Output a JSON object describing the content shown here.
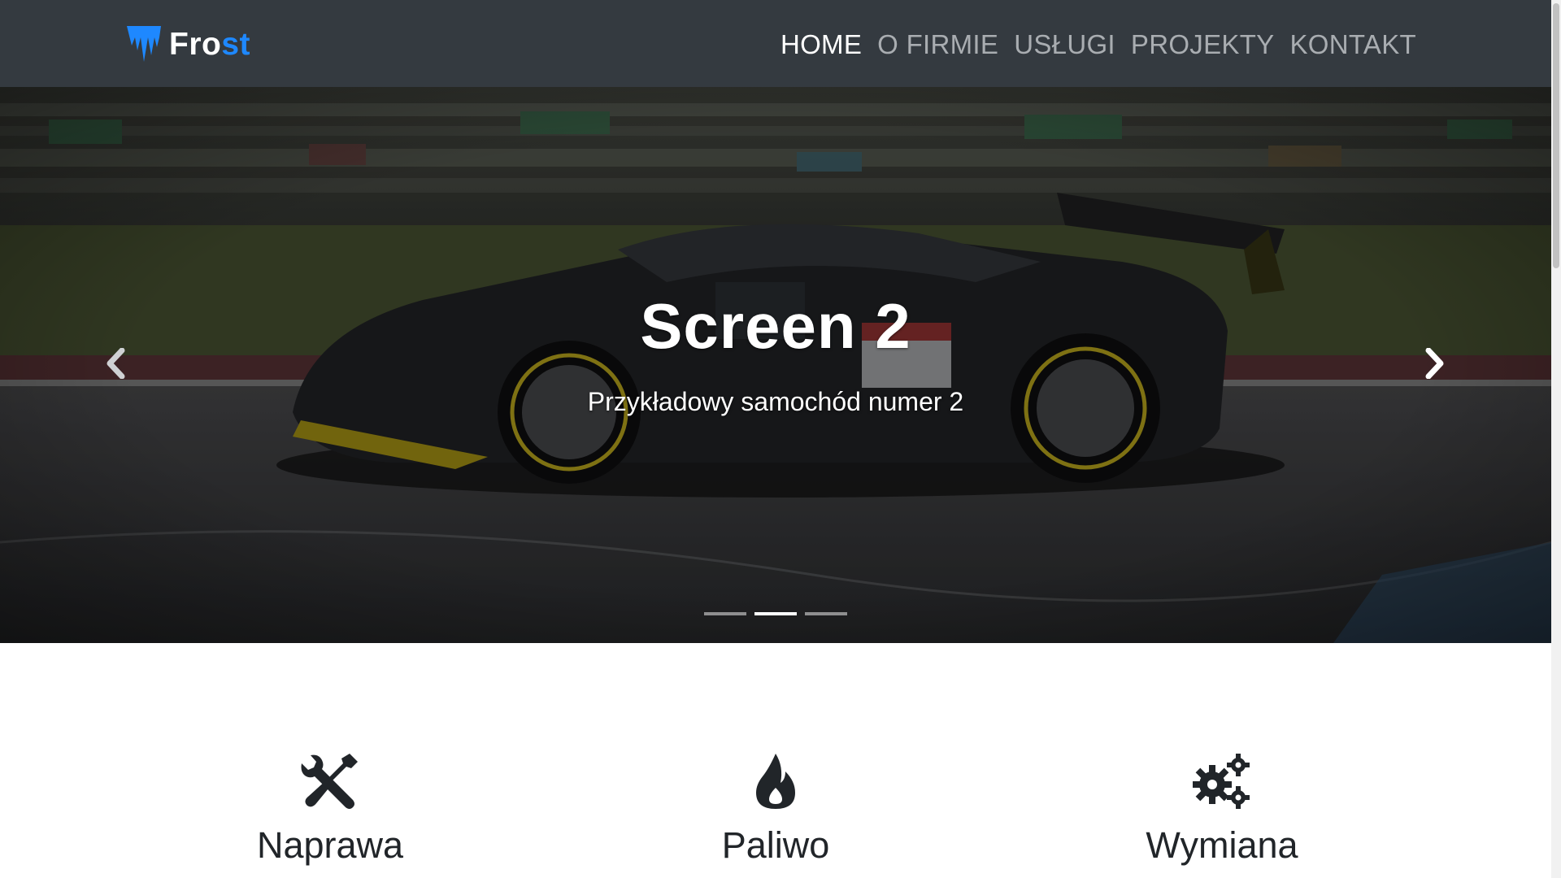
{
  "brand": {
    "part1": "Fro",
    "part2": "st",
    "logo_icon": "icicle-logo-icon",
    "accent_color": "#1e88ff"
  },
  "nav": {
    "items": [
      {
        "label": "HOME",
        "active": true
      },
      {
        "label": "O FIRMIE",
        "active": false
      },
      {
        "label": "USŁUGI",
        "active": false
      },
      {
        "label": "PROJEKTY",
        "active": false
      },
      {
        "label": "KONTAKT",
        "active": false
      }
    ]
  },
  "carousel": {
    "title": "Screen 2",
    "subtitle": "Przykładowy samochód numer 2",
    "prev_icon": "chevron-left-icon",
    "next_icon": "chevron-right-icon",
    "slide_count": 3,
    "active_index": 2
  },
  "features": [
    {
      "title": "Naprawa",
      "icon": "tools-icon"
    },
    {
      "title": "Paliwo",
      "icon": "fire-icon"
    },
    {
      "title": "Wymiana",
      "icon": "cogs-icon"
    }
  ]
}
